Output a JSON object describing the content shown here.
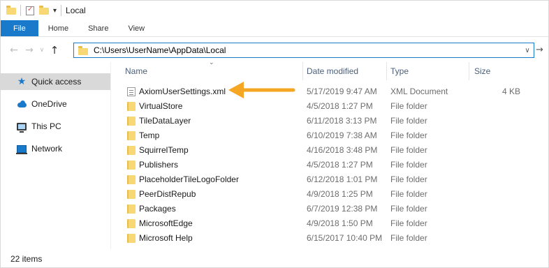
{
  "title": {
    "window_title": "Local",
    "dropdown_glyph": "▾"
  },
  "ribbon": {
    "tabs": [
      {
        "label": "File"
      },
      {
        "label": "Home"
      },
      {
        "label": "Share"
      },
      {
        "label": "View"
      }
    ]
  },
  "navigation": {
    "back_glyph": "←",
    "forward_glyph": "→",
    "recent_glyph": "∨",
    "up_glyph": "↑",
    "address_path": "C:\\Users\\UserName\\AppData\\Local",
    "address_dropdown_glyph": "∨",
    "go_glyph": "→"
  },
  "sidebar": {
    "items": [
      {
        "label": "Quick access",
        "icon": "star-icon",
        "selected": true
      },
      {
        "label": "OneDrive",
        "icon": "cloud-icon",
        "selected": false
      },
      {
        "label": "This PC",
        "icon": "computer-icon",
        "selected": false
      },
      {
        "label": "Network",
        "icon": "network-icon",
        "selected": false
      }
    ],
    "star_glyph": "★"
  },
  "filelist": {
    "sort_glyph": "⌄",
    "columns": {
      "name": "Name",
      "date": "Date modified",
      "type": "Type",
      "size": "Size"
    },
    "rows": [
      {
        "name": "AxiomUserSettings.xml",
        "date": "5/17/2019 9:47 AM",
        "type": "XML Document",
        "size": "4 KB",
        "icon": "xml-file-icon"
      },
      {
        "name": "VirtualStore",
        "date": "4/5/2018 1:27 PM",
        "type": "File folder",
        "size": "",
        "icon": "folder-icon"
      },
      {
        "name": "TileDataLayer",
        "date": "6/11/2018 3:13 PM",
        "type": "File folder",
        "size": "",
        "icon": "folder-icon"
      },
      {
        "name": "Temp",
        "date": "6/10/2019 7:38 AM",
        "type": "File folder",
        "size": "",
        "icon": "folder-icon"
      },
      {
        "name": "SquirrelTemp",
        "date": "4/16/2018 3:48 PM",
        "type": "File folder",
        "size": "",
        "icon": "folder-icon"
      },
      {
        "name": "Publishers",
        "date": "4/5/2018 1:27 PM",
        "type": "File folder",
        "size": "",
        "icon": "folder-icon"
      },
      {
        "name": "PlaceholderTileLogoFolder",
        "date": "6/12/2018 1:01 PM",
        "type": "File folder",
        "size": "",
        "icon": "folder-icon"
      },
      {
        "name": "PeerDistRepub",
        "date": "4/9/2018 1:25 PM",
        "type": "File folder",
        "size": "",
        "icon": "folder-icon"
      },
      {
        "name": "Packages",
        "date": "6/7/2019 12:38 PM",
        "type": "File folder",
        "size": "",
        "icon": "folder-icon"
      },
      {
        "name": "MicrosoftEdge",
        "date": "4/9/2018 1:50 PM",
        "type": "File folder",
        "size": "",
        "icon": "folder-icon"
      },
      {
        "name": "Microsoft Help",
        "date": "6/15/2017 10:40 PM",
        "type": "File folder",
        "size": "",
        "icon": "folder-icon"
      }
    ]
  },
  "status": {
    "item_count": "22 items"
  },
  "colors": {
    "accent": "#1979ca",
    "arrow": "#f5a623",
    "folder": "#f8d775"
  }
}
